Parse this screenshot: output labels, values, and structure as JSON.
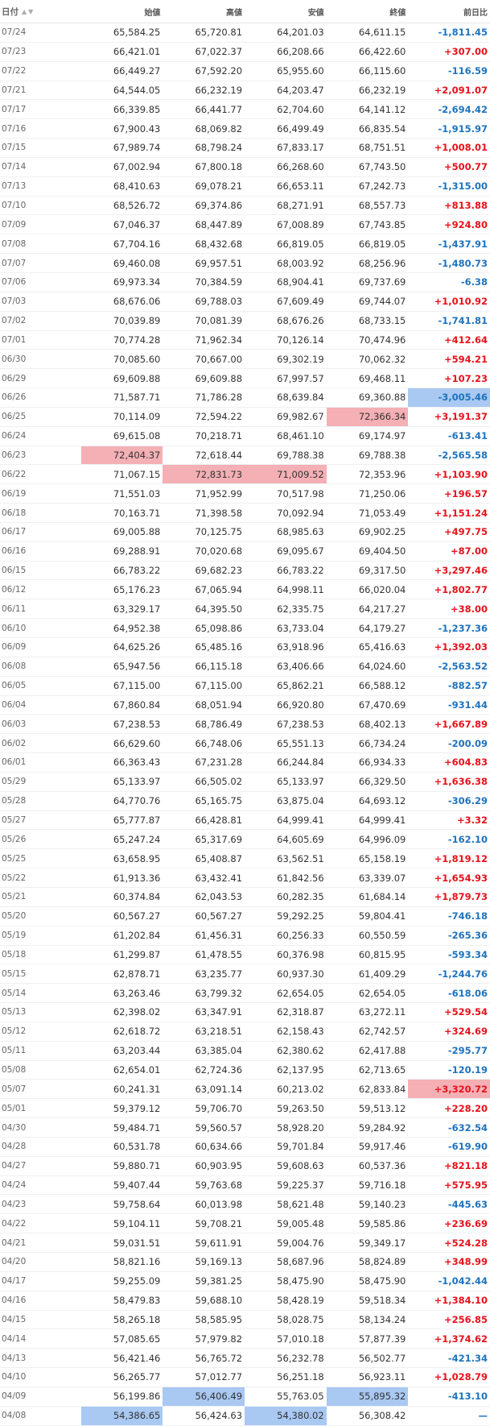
{
  "header": {
    "date": "日付",
    "open": "始値",
    "high": "高値",
    "low": "安値",
    "close": "終値",
    "change": "前日比"
  },
  "rows": [
    {
      "date": "07/24",
      "open": "65,584.25",
      "high": "65,720.81",
      "low": "64,201.03",
      "close": "64,611.15",
      "change": "-1,811.45",
      "dir": "neg",
      "hl": ""
    },
    {
      "date": "07/23",
      "open": "66,421.01",
      "high": "67,022.37",
      "low": "66,208.66",
      "close": "66,422.60",
      "change": "+307.00",
      "dir": "pos",
      "hl": ""
    },
    {
      "date": "07/22",
      "open": "66,449.27",
      "high": "67,592.20",
      "low": "65,955.60",
      "close": "66,115.60",
      "change": "-116.59",
      "dir": "neg",
      "hl": ""
    },
    {
      "date": "07/21",
      "open": "64,544.05",
      "high": "66,232.19",
      "low": "64,203.47",
      "close": "66,232.19",
      "change": "+2,091.07",
      "dir": "pos",
      "hl": ""
    },
    {
      "date": "07/17",
      "open": "66,339.85",
      "high": "66,441.77",
      "low": "62,704.60",
      "close": "64,141.12",
      "change": "-2,694.42",
      "dir": "neg",
      "hl": ""
    },
    {
      "date": "07/16",
      "open": "67,900.43",
      "high": "68,069.82",
      "low": "66,499.49",
      "close": "66,835.54",
      "change": "-1,915.97",
      "dir": "neg",
      "hl": ""
    },
    {
      "date": "07/15",
      "open": "67,989.74",
      "high": "68,798.24",
      "low": "67,833.17",
      "close": "68,751.51",
      "change": "+1,008.01",
      "dir": "pos",
      "hl": ""
    },
    {
      "date": "07/14",
      "open": "67,002.94",
      "high": "67,800.18",
      "low": "66,268.60",
      "close": "67,743.50",
      "change": "+500.77",
      "dir": "pos",
      "hl": ""
    },
    {
      "date": "07/13",
      "open": "68,410.63",
      "high": "69,078.21",
      "low": "66,653.11",
      "close": "67,242.73",
      "change": "-1,315.00",
      "dir": "neg",
      "hl": ""
    },
    {
      "date": "07/10",
      "open": "68,526.72",
      "high": "69,374.86",
      "low": "68,271.91",
      "close": "68,557.73",
      "change": "+813.88",
      "dir": "pos",
      "hl": ""
    },
    {
      "date": "07/09",
      "open": "67,046.37",
      "high": "68,447.89",
      "low": "67,008.89",
      "close": "67,743.85",
      "change": "+924.80",
      "dir": "pos",
      "hl": ""
    },
    {
      "date": "07/08",
      "open": "67,704.16",
      "high": "68,432.68",
      "low": "66,819.05",
      "close": "66,819.05",
      "change": "-1,437.91",
      "dir": "neg",
      "hl": ""
    },
    {
      "date": "07/07",
      "open": "69,460.08",
      "high": "69,957.51",
      "low": "68,003.92",
      "close": "68,256.96",
      "change": "-1,480.73",
      "dir": "neg",
      "hl": ""
    },
    {
      "date": "07/06",
      "open": "69,973.34",
      "high": "70,384.59",
      "low": "68,904.41",
      "close": "69,737.69",
      "change": "-6.38",
      "dir": "neg",
      "hl": ""
    },
    {
      "date": "07/03",
      "open": "68,676.06",
      "high": "69,788.03",
      "low": "67,609.49",
      "close": "69,744.07",
      "change": "+1,010.92",
      "dir": "pos",
      "hl": ""
    },
    {
      "date": "07/02",
      "open": "70,039.89",
      "high": "70,081.39",
      "low": "68,676.26",
      "close": "68,733.15",
      "change": "-1,741.81",
      "dir": "neg",
      "hl": ""
    },
    {
      "date": "07/01",
      "open": "70,774.28",
      "high": "71,962.34",
      "low": "70,126.14",
      "close": "70,474.96",
      "change": "+412.64",
      "dir": "pos",
      "hl": ""
    },
    {
      "date": "06/30",
      "open": "70,085.60",
      "high": "70,667.00",
      "low": "69,302.19",
      "close": "70,062.32",
      "change": "+594.21",
      "dir": "pos",
      "hl": ""
    },
    {
      "date": "06/29",
      "open": "69,609.88",
      "high": "69,609.88",
      "low": "67,997.57",
      "close": "69,468.11",
      "change": "+107.23",
      "dir": "pos",
      "hl": ""
    },
    {
      "date": "06/26",
      "open": "71,587.71",
      "high": "71,786.28",
      "low": "68,639.84",
      "close": "69,360.88",
      "change": "-3,005.46",
      "dir": "neg",
      "hl": "chg-lo"
    },
    {
      "date": "06/25",
      "open": "70,114.09",
      "high": "72,594.22",
      "low": "69,982.67",
      "close": "72,366.34",
      "change": "+3,191.37",
      "dir": "pos",
      "hl": "close-hi"
    },
    {
      "date": "06/24",
      "open": "69,615.08",
      "high": "70,218.71",
      "low": "68,461.10",
      "close": "69,174.97",
      "change": "-613.41",
      "dir": "neg",
      "hl": ""
    },
    {
      "date": "06/23",
      "open": "72,404.37",
      "high": "72,618.44",
      "low": "69,788.38",
      "close": "69,788.38",
      "change": "-2,565.58",
      "dir": "neg",
      "hl": "open-hi"
    },
    {
      "date": "06/22",
      "open": "71,067.15",
      "high": "72,831.73",
      "low": "71,009.52",
      "close": "72,353.96",
      "change": "+1,103.90",
      "dir": "pos",
      "hl": "high-hi low-hi"
    },
    {
      "date": "06/19",
      "open": "71,551.03",
      "high": "71,952.99",
      "low": "70,517.98",
      "close": "71,250.06",
      "change": "+196.57",
      "dir": "pos",
      "hl": ""
    },
    {
      "date": "06/18",
      "open": "70,163.71",
      "high": "71,398.58",
      "low": "70,092.94",
      "close": "71,053.49",
      "change": "+1,151.24",
      "dir": "pos",
      "hl": ""
    },
    {
      "date": "06/17",
      "open": "69,005.88",
      "high": "70,125.75",
      "low": "68,985.63",
      "close": "69,902.25",
      "change": "+497.75",
      "dir": "pos",
      "hl": ""
    },
    {
      "date": "06/16",
      "open": "69,288.91",
      "high": "70,020.68",
      "low": "69,095.67",
      "close": "69,404.50",
      "change": "+87.00",
      "dir": "pos",
      "hl": ""
    },
    {
      "date": "06/15",
      "open": "66,783.22",
      "high": "69,682.23",
      "low": "66,783.22",
      "close": "69,317.50",
      "change": "+3,297.46",
      "dir": "pos",
      "hl": ""
    },
    {
      "date": "06/12",
      "open": "65,176.23",
      "high": "67,065.94",
      "low": "64,998.11",
      "close": "66,020.04",
      "change": "+1,802.77",
      "dir": "pos",
      "hl": ""
    },
    {
      "date": "06/11",
      "open": "63,329.17",
      "high": "64,395.50",
      "low": "62,335.75",
      "close": "64,217.27",
      "change": "+38.00",
      "dir": "pos",
      "hl": ""
    },
    {
      "date": "06/10",
      "open": "64,952.38",
      "high": "65,098.86",
      "low": "63,733.04",
      "close": "64,179.27",
      "change": "-1,237.36",
      "dir": "neg",
      "hl": ""
    },
    {
      "date": "06/09",
      "open": "64,625.26",
      "high": "65,485.16",
      "low": "63,918.96",
      "close": "65,416.63",
      "change": "+1,392.03",
      "dir": "pos",
      "hl": ""
    },
    {
      "date": "06/08",
      "open": "65,947.56",
      "high": "66,115.18",
      "low": "63,406.66",
      "close": "64,024.60",
      "change": "-2,563.52",
      "dir": "neg",
      "hl": ""
    },
    {
      "date": "06/05",
      "open": "67,115.00",
      "high": "67,115.00",
      "low": "65,862.21",
      "close": "66,588.12",
      "change": "-882.57",
      "dir": "neg",
      "hl": ""
    },
    {
      "date": "06/04",
      "open": "67,860.84",
      "high": "68,051.94",
      "low": "66,920.80",
      "close": "67,470.69",
      "change": "-931.44",
      "dir": "neg",
      "hl": ""
    },
    {
      "date": "06/03",
      "open": "67,238.53",
      "high": "68,786.49",
      "low": "67,238.53",
      "close": "68,402.13",
      "change": "+1,667.89",
      "dir": "pos",
      "hl": ""
    },
    {
      "date": "06/02",
      "open": "66,629.60",
      "high": "66,748.06",
      "low": "65,551.13",
      "close": "66,734.24",
      "change": "-200.09",
      "dir": "neg",
      "hl": ""
    },
    {
      "date": "06/01",
      "open": "66,363.43",
      "high": "67,231.28",
      "low": "66,244.84",
      "close": "66,934.33",
      "change": "+604.83",
      "dir": "pos",
      "hl": ""
    },
    {
      "date": "05/29",
      "open": "65,133.97",
      "high": "66,505.02",
      "low": "65,133.97",
      "close": "66,329.50",
      "change": "+1,636.38",
      "dir": "pos",
      "hl": ""
    },
    {
      "date": "05/28",
      "open": "64,770.76",
      "high": "65,165.75",
      "low": "63,875.04",
      "close": "64,693.12",
      "change": "-306.29",
      "dir": "neg",
      "hl": ""
    },
    {
      "date": "05/27",
      "open": "65,777.87",
      "high": "66,428.81",
      "low": "64,999.41",
      "close": "64,999.41",
      "change": "+3.32",
      "dir": "pos",
      "hl": ""
    },
    {
      "date": "05/26",
      "open": "65,247.24",
      "high": "65,317.69",
      "low": "64,605.69",
      "close": "64,996.09",
      "change": "-162.10",
      "dir": "neg",
      "hl": ""
    },
    {
      "date": "05/25",
      "open": "63,658.95",
      "high": "65,408.87",
      "low": "63,562.51",
      "close": "65,158.19",
      "change": "+1,819.12",
      "dir": "pos",
      "hl": ""
    },
    {
      "date": "05/22",
      "open": "61,913.36",
      "high": "63,432.41",
      "low": "61,842.56",
      "close": "63,339.07",
      "change": "+1,654.93",
      "dir": "pos",
      "hl": ""
    },
    {
      "date": "05/21",
      "open": "60,374.84",
      "high": "62,043.53",
      "low": "60,282.35",
      "close": "61,684.14",
      "change": "+1,879.73",
      "dir": "pos",
      "hl": ""
    },
    {
      "date": "05/20",
      "open": "60,567.27",
      "high": "60,567.27",
      "low": "59,292.25",
      "close": "59,804.41",
      "change": "-746.18",
      "dir": "neg",
      "hl": ""
    },
    {
      "date": "05/19",
      "open": "61,202.84",
      "high": "61,456.31",
      "low": "60,256.33",
      "close": "60,550.59",
      "change": "-265.36",
      "dir": "neg",
      "hl": ""
    },
    {
      "date": "05/18",
      "open": "61,299.87",
      "high": "61,478.55",
      "low": "60,376.98",
      "close": "60,815.95",
      "change": "-593.34",
      "dir": "neg",
      "hl": ""
    },
    {
      "date": "05/15",
      "open": "62,878.71",
      "high": "63,235.77",
      "low": "60,937.30",
      "close": "61,409.29",
      "change": "-1,244.76",
      "dir": "neg",
      "hl": ""
    },
    {
      "date": "05/14",
      "open": "63,263.46",
      "high": "63,799.32",
      "low": "62,654.05",
      "close": "62,654.05",
      "change": "-618.06",
      "dir": "neg",
      "hl": ""
    },
    {
      "date": "05/13",
      "open": "62,398.02",
      "high": "63,347.91",
      "low": "62,318.87",
      "close": "63,272.11",
      "change": "+529.54",
      "dir": "pos",
      "hl": ""
    },
    {
      "date": "05/12",
      "open": "62,618.72",
      "high": "63,218.51",
      "low": "62,158.43",
      "close": "62,742.57",
      "change": "+324.69",
      "dir": "pos",
      "hl": ""
    },
    {
      "date": "05/11",
      "open": "63,203.44",
      "high": "63,385.04",
      "low": "62,380.62",
      "close": "62,417.88",
      "change": "-295.77",
      "dir": "neg",
      "hl": ""
    },
    {
      "date": "05/08",
      "open": "62,654.01",
      "high": "62,724.36",
      "low": "62,137.95",
      "close": "62,713.65",
      "change": "-120.19",
      "dir": "neg",
      "hl": ""
    },
    {
      "date": "05/07",
      "open": "60,241.31",
      "high": "63,091.14",
      "low": "60,213.02",
      "close": "62,833.84",
      "change": "+3,320.72",
      "dir": "pos",
      "hl": "chg-hi"
    },
    {
      "date": "05/01",
      "open": "59,379.12",
      "high": "59,706.70",
      "low": "59,263.50",
      "close": "59,513.12",
      "change": "+228.20",
      "dir": "pos",
      "hl": ""
    },
    {
      "date": "04/30",
      "open": "59,484.71",
      "high": "59,560.57",
      "low": "58,928.20",
      "close": "59,284.92",
      "change": "-632.54",
      "dir": "neg",
      "hl": ""
    },
    {
      "date": "04/28",
      "open": "60,531.78",
      "high": "60,634.66",
      "low": "59,701.84",
      "close": "59,917.46",
      "change": "-619.90",
      "dir": "neg",
      "hl": ""
    },
    {
      "date": "04/27",
      "open": "59,880.71",
      "high": "60,903.95",
      "low": "59,608.63",
      "close": "60,537.36",
      "change": "+821.18",
      "dir": "pos",
      "hl": ""
    },
    {
      "date": "04/24",
      "open": "59,407.44",
      "high": "59,763.68",
      "low": "59,225.37",
      "close": "59,716.18",
      "change": "+575.95",
      "dir": "pos",
      "hl": ""
    },
    {
      "date": "04/23",
      "open": "59,758.64",
      "high": "60,013.98",
      "low": "58,621.48",
      "close": "59,140.23",
      "change": "-445.63",
      "dir": "neg",
      "hl": ""
    },
    {
      "date": "04/22",
      "open": "59,104.11",
      "high": "59,708.21",
      "low": "59,005.48",
      "close": "59,585.86",
      "change": "+236.69",
      "dir": "pos",
      "hl": ""
    },
    {
      "date": "04/21",
      "open": "59,031.51",
      "high": "59,611.91",
      "low": "59,004.76",
      "close": "59,349.17",
      "change": "+524.28",
      "dir": "pos",
      "hl": ""
    },
    {
      "date": "04/20",
      "open": "58,821.16",
      "high": "59,169.13",
      "low": "58,687.96",
      "close": "58,824.89",
      "change": "+348.99",
      "dir": "pos",
      "hl": ""
    },
    {
      "date": "04/17",
      "open": "59,255.09",
      "high": "59,381.25",
      "low": "58,475.90",
      "close": "58,475.90",
      "change": "-1,042.44",
      "dir": "neg",
      "hl": ""
    },
    {
      "date": "04/16",
      "open": "58,479.83",
      "high": "59,688.10",
      "low": "58,428.19",
      "close": "59,518.34",
      "change": "+1,384.10",
      "dir": "pos",
      "hl": ""
    },
    {
      "date": "04/15",
      "open": "58,265.18",
      "high": "58,585.95",
      "low": "58,028.75",
      "close": "58,134.24",
      "change": "+256.85",
      "dir": "pos",
      "hl": ""
    },
    {
      "date": "04/14",
      "open": "57,085.65",
      "high": "57,979.82",
      "low": "57,010.18",
      "close": "57,877.39",
      "change": "+1,374.62",
      "dir": "pos",
      "hl": ""
    },
    {
      "date": "04/13",
      "open": "56,421.46",
      "high": "56,765.72",
      "low": "56,232.78",
      "close": "56,502.77",
      "change": "-421.34",
      "dir": "neg",
      "hl": ""
    },
    {
      "date": "04/10",
      "open": "56,265.77",
      "high": "57,012.77",
      "low": "56,251.18",
      "close": "56,923.11",
      "change": "+1,028.79",
      "dir": "pos",
      "hl": ""
    },
    {
      "date": "04/09",
      "open": "56,199.86",
      "high": "56,406.49",
      "low": "55,763.05",
      "close": "55,895.32",
      "change": "-413.10",
      "dir": "neg",
      "hl": "high-lo close-lo"
    },
    {
      "date": "04/08",
      "open": "54,386.65",
      "high": "56,424.63",
      "low": "54,380.02",
      "close": "56,308.42",
      "change": "—",
      "dir": "zero",
      "hl": "open-lo low-lo"
    }
  ],
  "colors": {
    "up": "#e8111a",
    "down": "#1e73be",
    "highlight_high": "#f4b0b5",
    "highlight_low": "#a9c8f2"
  },
  "icons": {
    "sort": [
      "sort-asc-icon",
      "sort-desc-icon"
    ]
  }
}
